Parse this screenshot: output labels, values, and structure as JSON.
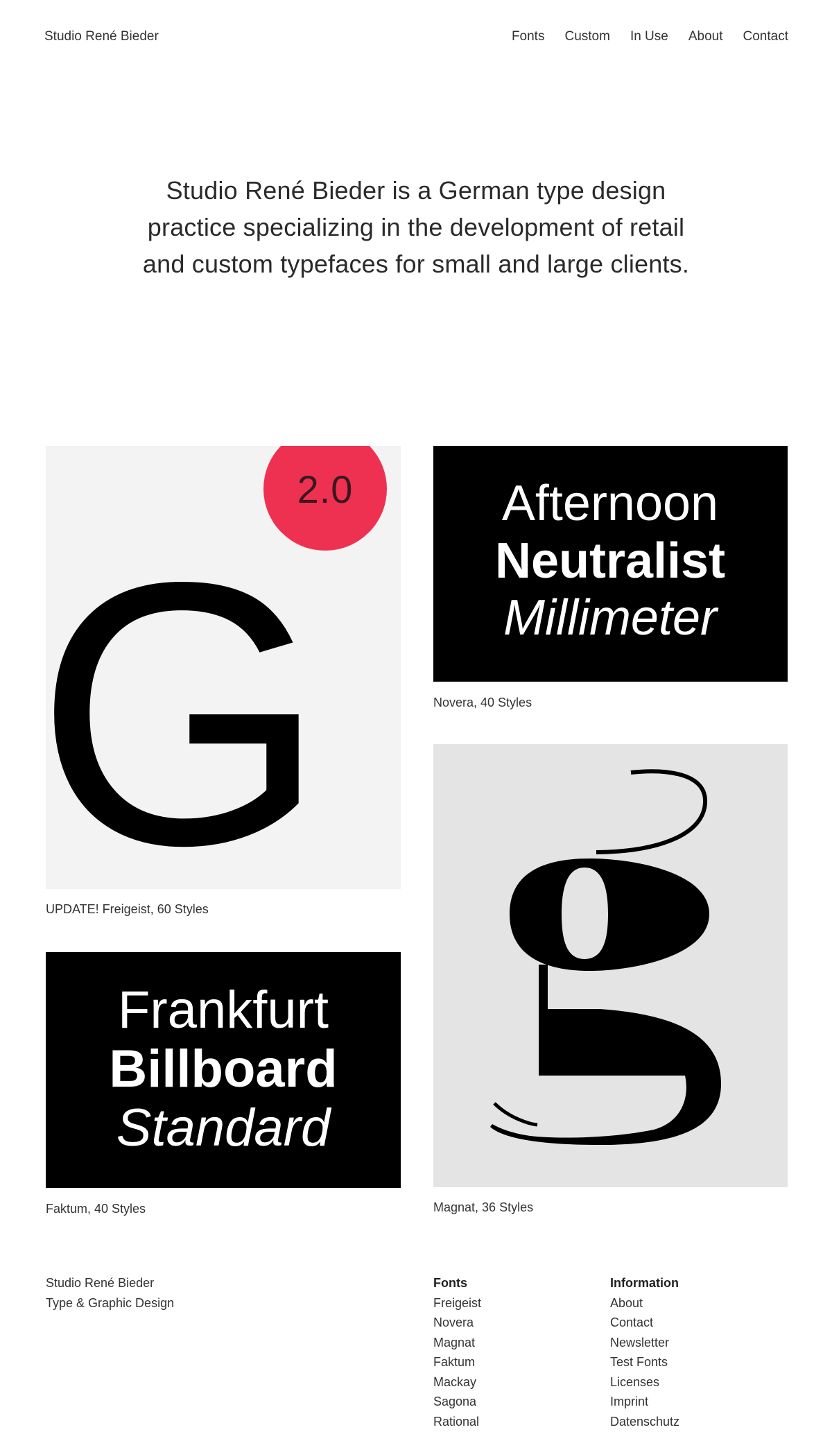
{
  "header": {
    "brand": "Studio René Bieder",
    "nav": [
      "Fonts",
      "Custom",
      "In Use",
      "About",
      "Contact"
    ]
  },
  "intro": "Studio René Bieder is a German type design practice specializing in the development of retail and custom typefaces for small and large clients.",
  "cards": {
    "freigeist": {
      "caption": "UPDATE! Freigeist, 60 Styles",
      "badge": "2.0",
      "glyph": "G"
    },
    "novera": {
      "caption": "Novera, 40 Styles",
      "lines": [
        "Afternoon",
        "Neutralist",
        "Millimeter"
      ]
    },
    "faktum": {
      "caption": "Faktum, 40 Styles",
      "lines": [
        "Frankfurt",
        "Billboard",
        "Standard"
      ]
    },
    "magnat": {
      "caption": "Magnat, 36 Styles"
    }
  },
  "footer": {
    "studio": [
      "Studio René Bieder",
      "Type & Graphic Design"
    ],
    "fonts_heading": "Fonts",
    "fonts": [
      "Freigeist",
      "Novera",
      "Magnat",
      "Faktum",
      "Mackay",
      "Sagona",
      "Rational"
    ],
    "info_heading": "Information",
    "info": [
      "About",
      "Contact",
      "Newsletter",
      "Test Fonts",
      "Licenses",
      "Imprint",
      "Datenschutz"
    ]
  },
  "colors": {
    "badge": "#ef3151",
    "badge_text": "#3a1820",
    "panel_light": "#f3f3f4",
    "panel_grey": "#e4e4e4",
    "panel_black": "#000000"
  }
}
